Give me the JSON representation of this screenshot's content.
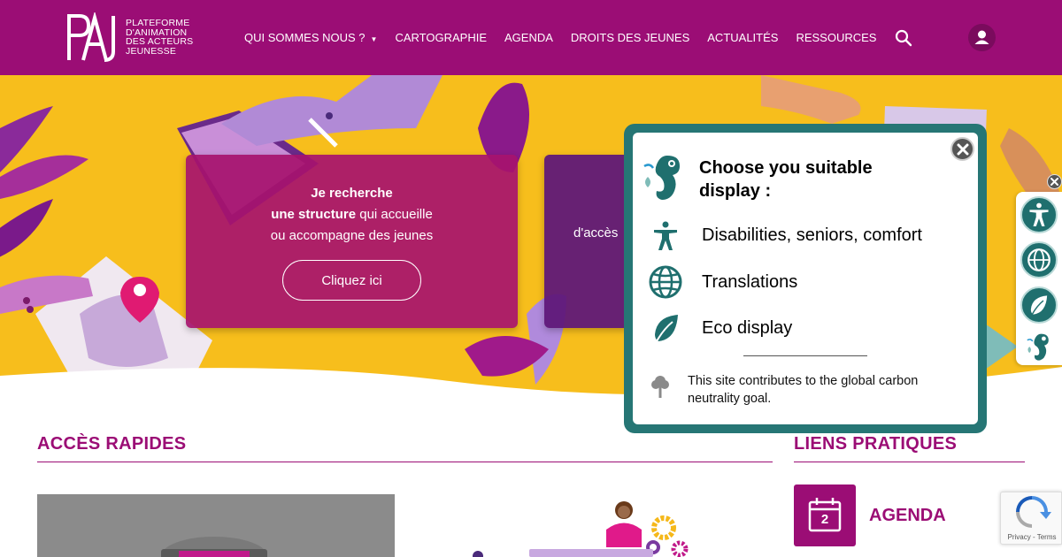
{
  "header": {
    "logo_letters": "PAJ",
    "logo_lines": [
      "PLATEFORME",
      "D'ANIMATION",
      "DES ACTEURS",
      "JEUNESSE"
    ],
    "nav": [
      {
        "label": "QUI SOMMES NOUS ?",
        "has_dropdown": true
      },
      {
        "label": "CARTOGRAPHIE"
      },
      {
        "label": "AGENDA"
      },
      {
        "label": "DROITS DES JEUNES"
      },
      {
        "label": "ACTUALITÉS"
      },
      {
        "label": "RESSOURCES"
      }
    ],
    "search_icon": "search-icon",
    "user_icon": "user-icon",
    "color": "#9b0d75"
  },
  "hero": {
    "card1": {
      "line1": "Je recherche",
      "line2_bold": "une structure",
      "line2_rest": " qui accueille",
      "line3": "ou accompagne des jeunes",
      "button": "Cliquez ici"
    },
    "card2": {
      "text": "d'accès"
    }
  },
  "popup": {
    "title": "Choose you suitable display :",
    "options": [
      {
        "label": "Disabilities, seniors, comfort",
        "icon": "accessibility-icon"
      },
      {
        "label": "Translations",
        "icon": "globe-icon"
      },
      {
        "label": "Eco display",
        "icon": "leaf-icon"
      }
    ],
    "note": "This site contributes to the global carbon neutrality goal.",
    "note_icon": "tree-icon",
    "logo_icon": "seahorse-icon",
    "accent": "#267675"
  },
  "side_toolbar": {
    "buttons": [
      "accessibility-icon",
      "globe-icon",
      "leaf-icon",
      "seahorse-icon"
    ]
  },
  "sections": {
    "quick_access": "ACCÈS RAPIDES",
    "useful_links": "LIENS PRATIQUES",
    "agenda_tile_day": "2",
    "agenda_label": "AGENDA"
  },
  "recaptcha": {
    "links": "Privacy - Terms"
  }
}
